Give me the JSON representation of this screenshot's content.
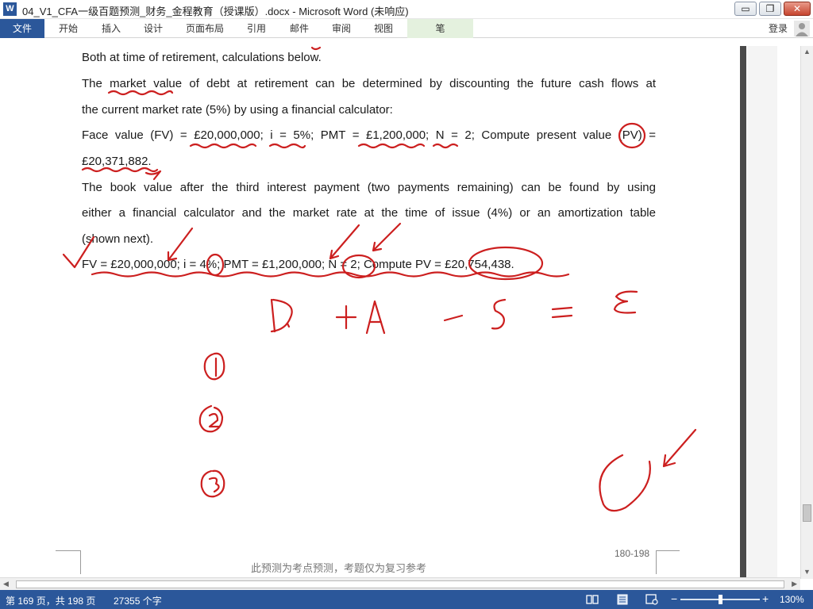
{
  "window": {
    "title": "04_V1_CFA一级百题预测_财务_金程教育（授课版）.docx - Microsoft Word (未响应)",
    "app_icon": "W",
    "minimize": "▭",
    "maximize": "❐",
    "close": "✕"
  },
  "ribbon": {
    "file_tab": "文件",
    "tabs": [
      "开始",
      "插入",
      "设计",
      "页面布局",
      "引用",
      "邮件",
      "审阅",
      "视图"
    ],
    "pen_tab": "笔",
    "login": "登录"
  },
  "document": {
    "lines": [
      "Both at time of retirement, calculations below.",
      "The market value of debt at retirement can be determined by discounting the future cash flows at",
      "the current market rate (5%) by using a financial calculator:",
      "Face value (FV) = £20,000,000; i = 5%; PMT = £1,200,000; N = 2; Compute present value (PV) =",
      "£20,371,882.",
      "The book value after the third interest payment (two payments remaining) can be found by using",
      "either a financial calculator and the market rate at the time of issue (4%) or an amortization table",
      "(shown next).",
      "FV = £20,000,000; i = 4%; PMT = £1,200,000; N = 2; Compute PV = £20,754,438."
    ],
    "footer_note": "此预测为考点预测，考题仅为复习参考",
    "page_range": "180-198"
  },
  "statusbar": {
    "page": "第 169 页，共 198 页",
    "words": "27355 个字",
    "zoom_minus": "−",
    "zoom_plus": "+",
    "zoom": "130%",
    "zoom_fraction": 0.5
  },
  "colors": {
    "accent": "#2b579a",
    "ink": "#cc1f1f",
    "pen_tab": "#e4f1de"
  },
  "icons": {
    "user": "user-icon",
    "read_mode": "read-mode-icon",
    "print_layout": "print-layout-icon",
    "web_layout": "web-layout-icon"
  }
}
